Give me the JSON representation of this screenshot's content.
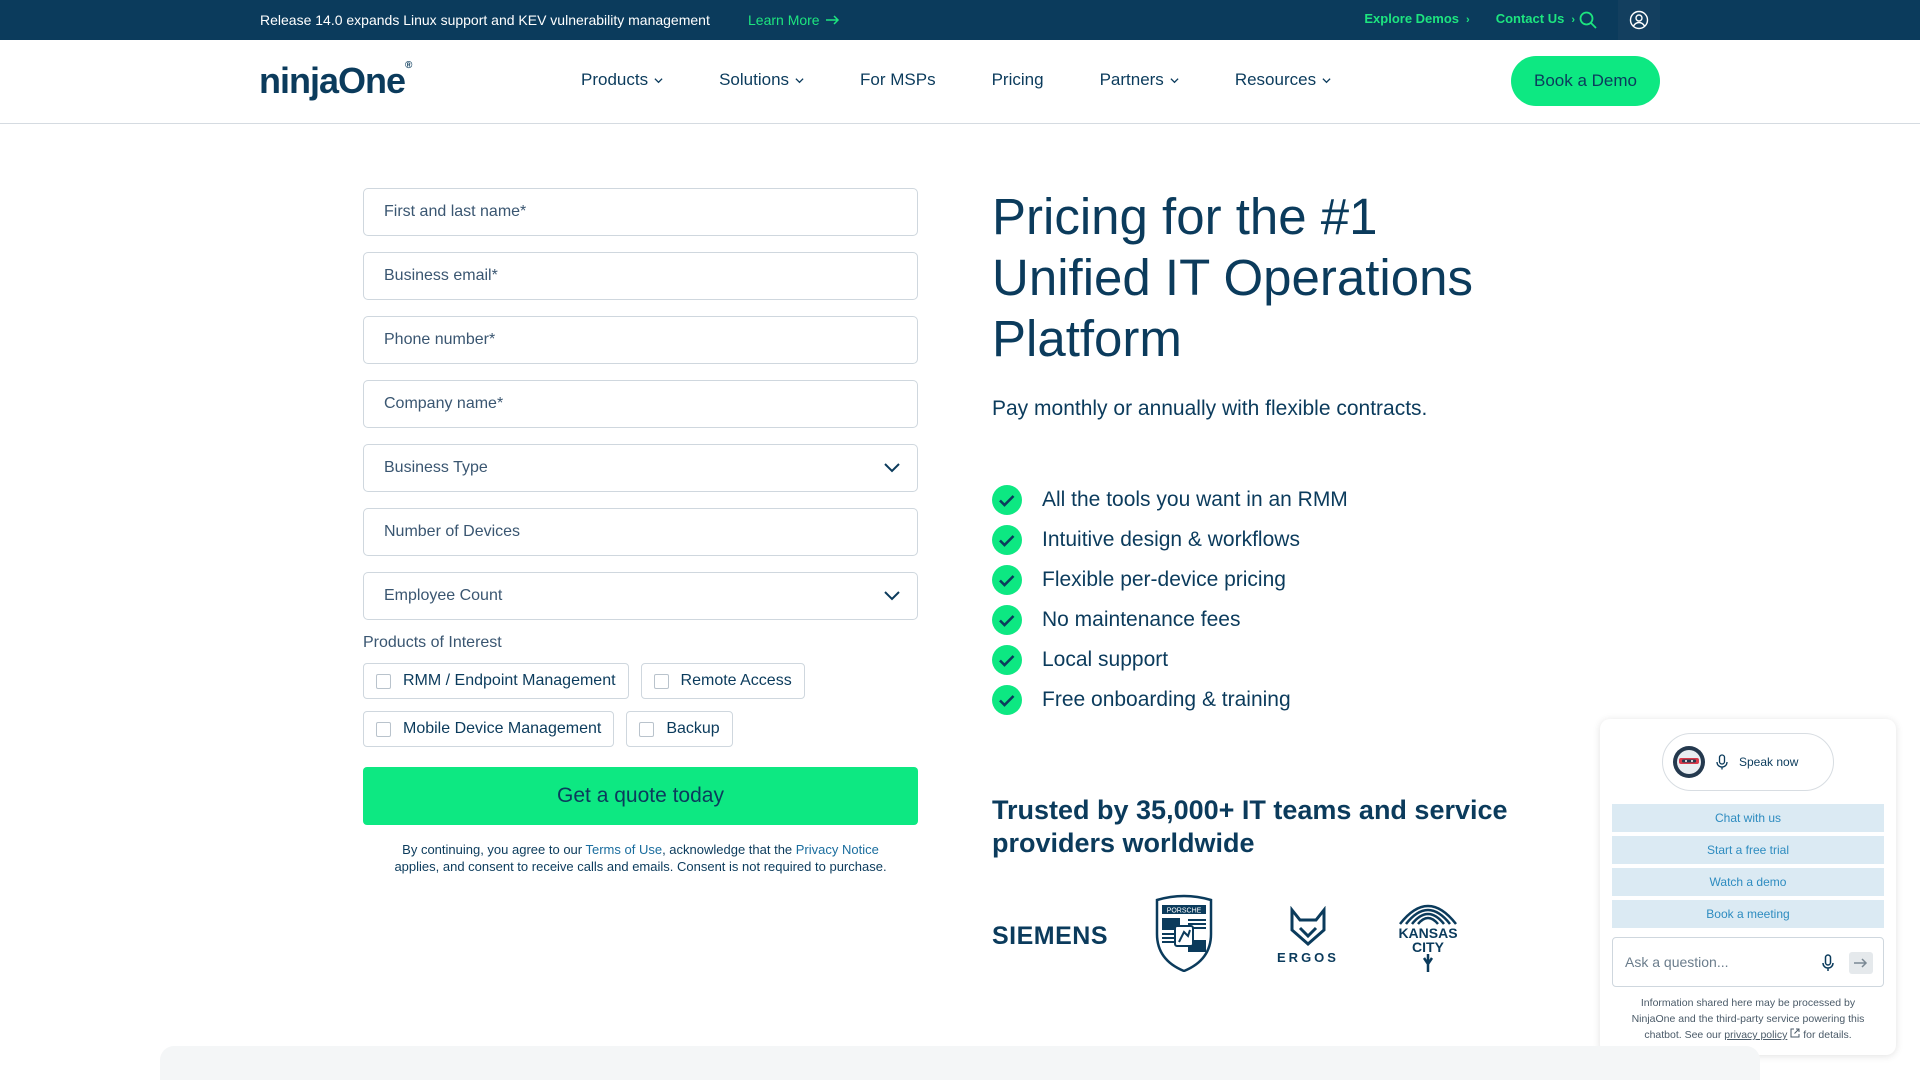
{
  "announcement": {
    "message": "Release 14.0 expands Linux support and KEV vulnerability management",
    "learn_more": "Learn More",
    "explore_demos": "Explore Demos",
    "contact_us": "Contact Us"
  },
  "header": {
    "logo": "ninjaOne",
    "nav": [
      "Products",
      "Solutions",
      "For MSPs",
      "Pricing",
      "Partners",
      "Resources"
    ],
    "book_demo": "Book a Demo"
  },
  "form": {
    "fields": {
      "name": "First and last name*",
      "email": "Business email*",
      "phone": "Phone number*",
      "company": "Company name*",
      "business_type": "Business Type",
      "devices": "Number of Devices",
      "employee_count": "Employee Count"
    },
    "products_label": "Products of Interest",
    "products": [
      "RMM / Endpoint Management",
      "Remote Access",
      "Mobile Device Management",
      "Backup"
    ],
    "submit": "Get a quote today",
    "legal": {
      "part1": "By continuing, you agree to our ",
      "terms": "Terms of Use",
      "part2": ", acknowledge that the ",
      "privacy": "Privacy Notice",
      "part3": "applies, and consent to receive calls and emails. Consent is not required to purchase."
    }
  },
  "hero": {
    "title_line1": "Pricing for the #1",
    "title_line2": "Unified IT Operations",
    "title_line3": "Platform",
    "subtitle": "Pay monthly or annually with flexible contracts.",
    "features": [
      "All the tools you want in an RMM",
      "Intuitive design & workflows",
      "Flexible per-device pricing",
      "No maintenance fees",
      "Local support",
      "Free onboarding & training"
    ],
    "trusted": "Trusted by 35,000+ IT teams and service providers worldwide",
    "logos": {
      "siemens": "SIEMENS",
      "porsche": "PORSCHE",
      "ergos": "ERGOS",
      "kc_line1": "KANSAS",
      "kc_line2": "CITY"
    }
  },
  "chat": {
    "speak_now": "Speak now",
    "options": [
      "Chat with us",
      "Start a free trial",
      "Watch a demo",
      "Book a meeting"
    ],
    "ask_placeholder": "Ask a question...",
    "note_part1": "Information shared here may be processed by NinjaOne and the third-party service powering this chatbot. See our ",
    "privacy_policy": "privacy policy",
    "note_part2": " for details."
  },
  "colors": {
    "navy": "#0b3b5c",
    "green": "#0de882",
    "link_green": "#1de57f"
  }
}
